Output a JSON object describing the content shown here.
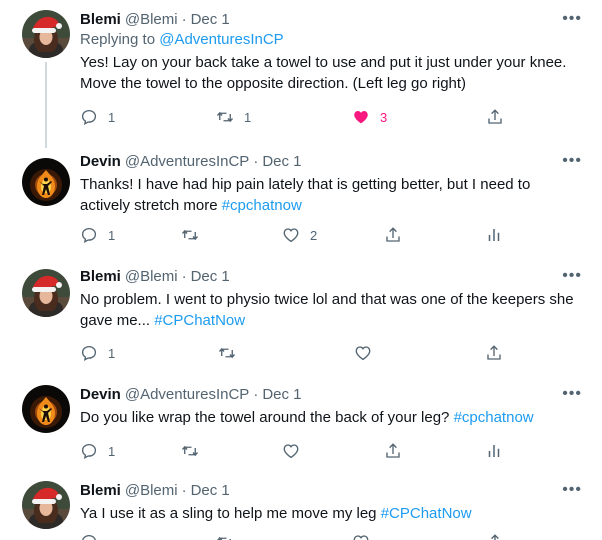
{
  "tweets": [
    {
      "name": "Blemi",
      "handle": "@Blemi",
      "separator": "·",
      "date": "Dec 1",
      "replying_prefix": "Replying to",
      "replying_to": "@AdventuresInCP",
      "text_1": "Yes! Lay on your back take a towel to use and put it just under your knee. Move the towel to the opposite direction. (Left leg go right)",
      "hashtag": "",
      "reply_count": "1",
      "retweet_count": "1",
      "like_count": "3",
      "liked": true,
      "avatar": "woman-santa-hat"
    },
    {
      "name": "Devin",
      "handle": "@AdventuresInCP",
      "separator": "·",
      "date": "Dec 1",
      "text_1": "Thanks! I have had hip pain lately that is getting better, but I need to actively stretch more ",
      "hashtag": "#cpchatnow",
      "reply_count": "1",
      "retweet_count": "",
      "like_count": "2",
      "avatar": "dark-fire-figure"
    },
    {
      "name": "Blemi",
      "handle": "@Blemi",
      "separator": "·",
      "date": "Dec 1",
      "text_1": "No problem.  I went to physio twice lol and that was one of the keepers she gave me... ",
      "hashtag": "#CPChatNow",
      "reply_count": "1",
      "retweet_count": "",
      "like_count": "",
      "avatar": "woman-santa-hat"
    },
    {
      "name": "Devin",
      "handle": "@AdventuresInCP",
      "separator": "·",
      "date": "Dec 1",
      "text_1": "Do you like wrap the towel around the back of your leg? ",
      "hashtag": "#cpchatnow",
      "reply_count": "1",
      "retweet_count": "",
      "like_count": "",
      "avatar": "dark-fire-figure"
    },
    {
      "name": "Blemi",
      "handle": "@Blemi",
      "separator": "·",
      "date": "Dec 1",
      "text_1": "Ya I use it as a sling to help me move my leg ",
      "hashtag": "#CPChatNow",
      "avatar": "woman-santa-hat"
    }
  ],
  "more_label": "•••",
  "colors": {
    "link": "#1d9bf0",
    "like": "#f91880",
    "muted": "#536471",
    "thread_line": "#cfd9de"
  },
  "icons": [
    "reply-icon",
    "retweet-icon",
    "like-icon",
    "share-icon",
    "analytics-icon",
    "more-icon"
  ]
}
